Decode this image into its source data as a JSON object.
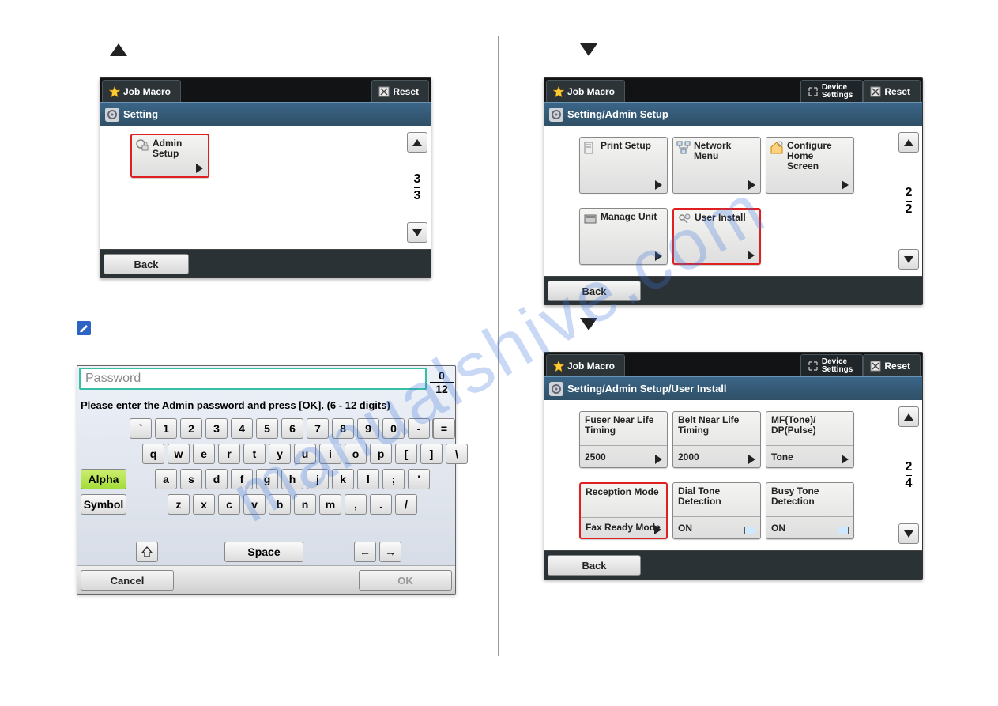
{
  "watermark": "manualshive.com",
  "arrows": {
    "up": "▲",
    "down": "▼"
  },
  "panel1": {
    "tabs": {
      "jobmacro": "Job Macro",
      "reset": "Reset"
    },
    "breadcrumb": "Setting",
    "tile": "Admin Setup",
    "page": {
      "cur": "3",
      "total": "3"
    },
    "back": "Back"
  },
  "keyboard": {
    "placeholder": "Password",
    "counter": {
      "cur": "0",
      "max": "12"
    },
    "hint": "Please enter the Admin password and press [OK]. (6 - 12 digits)",
    "row1": [
      "`",
      "1",
      "2",
      "3",
      "4",
      "5",
      "6",
      "7",
      "8",
      "9",
      "0",
      "-",
      "="
    ],
    "row2": [
      "q",
      "w",
      "e",
      "r",
      "t",
      "y",
      "u",
      "i",
      "o",
      "p",
      "[",
      "]",
      "\\"
    ],
    "row3": [
      "a",
      "s",
      "d",
      "f",
      "g",
      "h",
      "j",
      "k",
      "l",
      ";",
      "'"
    ],
    "row4": [
      "z",
      "x",
      "c",
      "v",
      "b",
      "n",
      "m",
      ",",
      ".",
      "/"
    ],
    "alpha": "Alpha",
    "symbol": "Symbol",
    "space": "Space",
    "cancel": "Cancel",
    "ok": "OK"
  },
  "panel2": {
    "tabs": {
      "jobmacro": "Job Macro",
      "device": "Device\nSettings",
      "reset": "Reset"
    },
    "breadcrumb": "Setting/Admin Setup",
    "tiles": [
      {
        "name": "print-setup",
        "label": "Print Setup"
      },
      {
        "name": "network-menu",
        "label": "Network\nMenu"
      },
      {
        "name": "configure-home",
        "label": "Configure\nHome\nScreen"
      },
      {
        "name": "manage-unit",
        "label": "Manage Unit"
      },
      {
        "name": "user-install",
        "label": "User Install",
        "hl": true
      }
    ],
    "page": {
      "cur": "2",
      "total": "2"
    },
    "back": "Back"
  },
  "panel3": {
    "tabs": {
      "jobmacro": "Job Macro",
      "device": "Device\nSettings",
      "reset": "Reset"
    },
    "breadcrumb": "Setting/Admin Setup/User Install",
    "tiles": [
      {
        "name": "fuser",
        "label": "Fuser Near Life\nTiming",
        "value": "2500",
        "arrow": true
      },
      {
        "name": "belt",
        "label": "Belt Near Life\nTiming",
        "value": "2000",
        "arrow": true
      },
      {
        "name": "mftone",
        "label": "MF(Tone)/\nDP(Pulse)",
        "value": "Tone",
        "arrow": true
      },
      {
        "name": "reception",
        "label": "Reception Mode",
        "value": "Fax Ready Mode",
        "arrow": true,
        "hl": true
      },
      {
        "name": "dialtone",
        "label": "Dial Tone\nDetection",
        "value": "ON",
        "check": true
      },
      {
        "name": "busytone",
        "label": "Busy Tone\nDetection",
        "value": "ON",
        "check": true
      }
    ],
    "page": {
      "cur": "2",
      "total": "4"
    },
    "back": "Back"
  }
}
